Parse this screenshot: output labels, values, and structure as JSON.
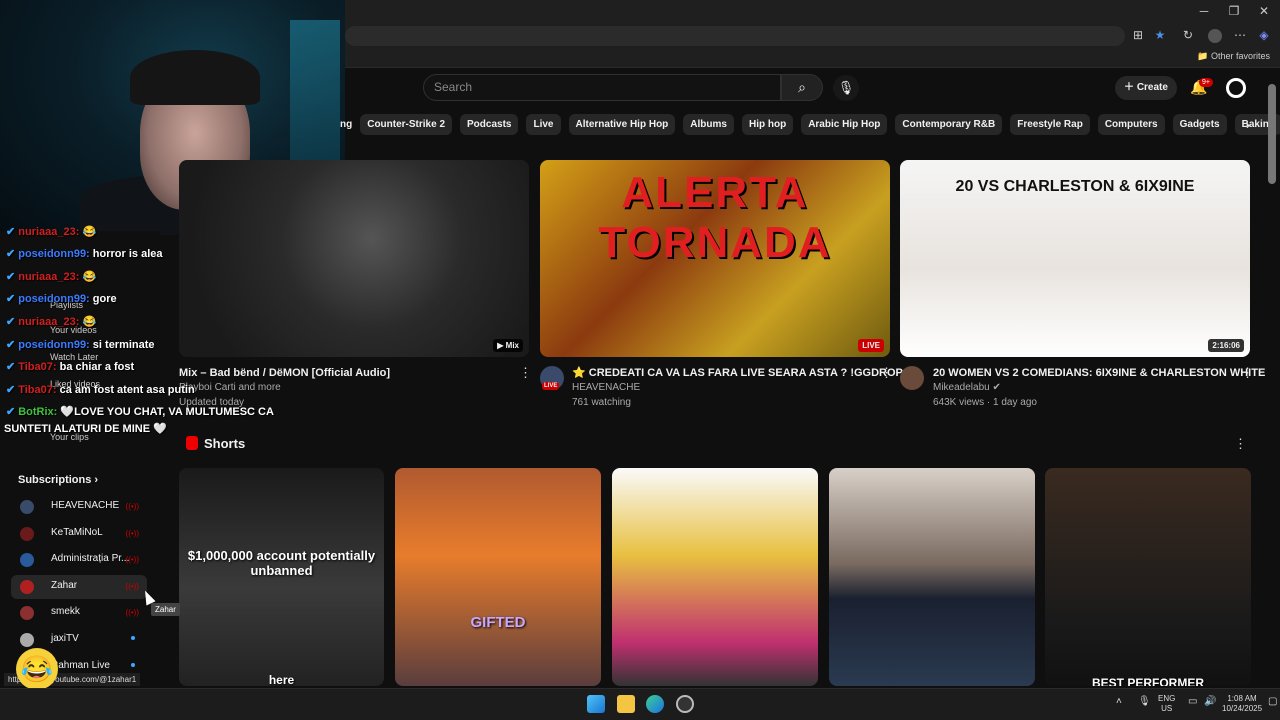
{
  "browser": {
    "other_favorites": "Other favorites",
    "controls": {
      "minimize": "─",
      "restore": "❐",
      "close": "✕"
    }
  },
  "header": {
    "search_placeholder": "Search",
    "create_label": "Create",
    "notif_badge": "9+"
  },
  "chips": [
    "ng",
    "Counter-Strike 2",
    "Podcasts",
    "Live",
    "Alternative Hip Hop",
    "Albums",
    "Hip hop",
    "Arabic Hip Hop",
    "Contemporary R&B",
    "Freestyle Rap",
    "Computers",
    "Gadgets",
    "Baking"
  ],
  "videos": [
    {
      "title": "Mix – Bad bënd / DëMON [Official Audio]",
      "channel": "Playboi Carti and more",
      "meta": "Updated today",
      "badge": "Mix"
    },
    {
      "thumb_text": "ALERTA TORNADA",
      "title": "⭐ CREDEATI CA VA LAS FARA LIVE SEARA ASTA ? !GGDROP",
      "channel": "HEAVENACHE",
      "meta": "761 watching",
      "badge": "LIVE",
      "avatar_badge": "LIVE"
    },
    {
      "thumb_text": "20 VS CHARLESTON & 6IX9INE",
      "title": "20 WOMEN VS 2 COMEDIANS: 6IX9INE & CHARLESTON WHITE",
      "channel": "Mikeadelabu",
      "meta": "643K views · 1 day ago",
      "badge": "2:16:06"
    }
  ],
  "shorts": {
    "heading": "Shorts",
    "items": [
      {
        "text": "$1,000,000 account potentially unbanned",
        "sub": "here"
      },
      {
        "text": "GIFTED"
      },
      {
        "text": ""
      },
      {
        "text": ""
      },
      {
        "text": "BEST PERFORMER"
      }
    ]
  },
  "sidebar": {
    "ghost_items": [
      "Playlists",
      "Your videos",
      "Watch Later",
      "Liked videos",
      "Your clips"
    ],
    "subscriptions_label": "Subscriptions",
    "subs": [
      {
        "name": "HEAVENACHE",
        "live": true,
        "color": "#3a4a6a"
      },
      {
        "name": "KeTaMiNoL",
        "live": true,
        "color": "#6a1a1a"
      },
      {
        "name": "Administrația Pr...",
        "live": true,
        "color": "#2a5a9a"
      },
      {
        "name": "Zahar",
        "live": true,
        "color": "#b02020"
      },
      {
        "name": "smekk",
        "live": true,
        "color": "#8a3030"
      },
      {
        "name": "jaxiTV",
        "live": false,
        "color": "#aaaaaa"
      },
      {
        "name": "Rahman Live",
        "live": false,
        "color": "#555555"
      }
    ],
    "tooltip": "Zahar",
    "status_url": "https://www.youtube.com/@1zahar1"
  },
  "chat": [
    {
      "user": "nuriaaa_23:",
      "msg": "😂",
      "cls": "r"
    },
    {
      "user": "poseidonn99:",
      "msg": "horror is alea",
      "cls": ""
    },
    {
      "user": "nuriaaa_23:",
      "msg": "😂",
      "cls": "r"
    },
    {
      "user": "poseidonn99:",
      "msg": "gore",
      "cls": ""
    },
    {
      "user": "nuriaaa_23:",
      "msg": "😂",
      "cls": "r"
    },
    {
      "user": "poseidonn99:",
      "msg": "si terminate",
      "cls": ""
    },
    {
      "user": "Tiba07:",
      "msg": "ba chiar a fost",
      "cls": "r"
    },
    {
      "user": "Tiba07:",
      "msg": "ca am fost atent asa putin",
      "cls": "r"
    },
    {
      "user": "BotRix:",
      "msg": "🤍LOVE YOU CHAT, VA MULTUMESC CA",
      "cls": "g"
    },
    {
      "user": "",
      "msg": "SUNTETI ALATURI DE MINE 🤍",
      "cls": ""
    }
  ],
  "taskbar": {
    "lang": "ENG",
    "region": "US",
    "time": "1:08 AM",
    "date": "10/24/2025"
  },
  "colors": {
    "bg": "#0f0f0f",
    "accent": "#cc0000",
    "chip": "#272727"
  }
}
